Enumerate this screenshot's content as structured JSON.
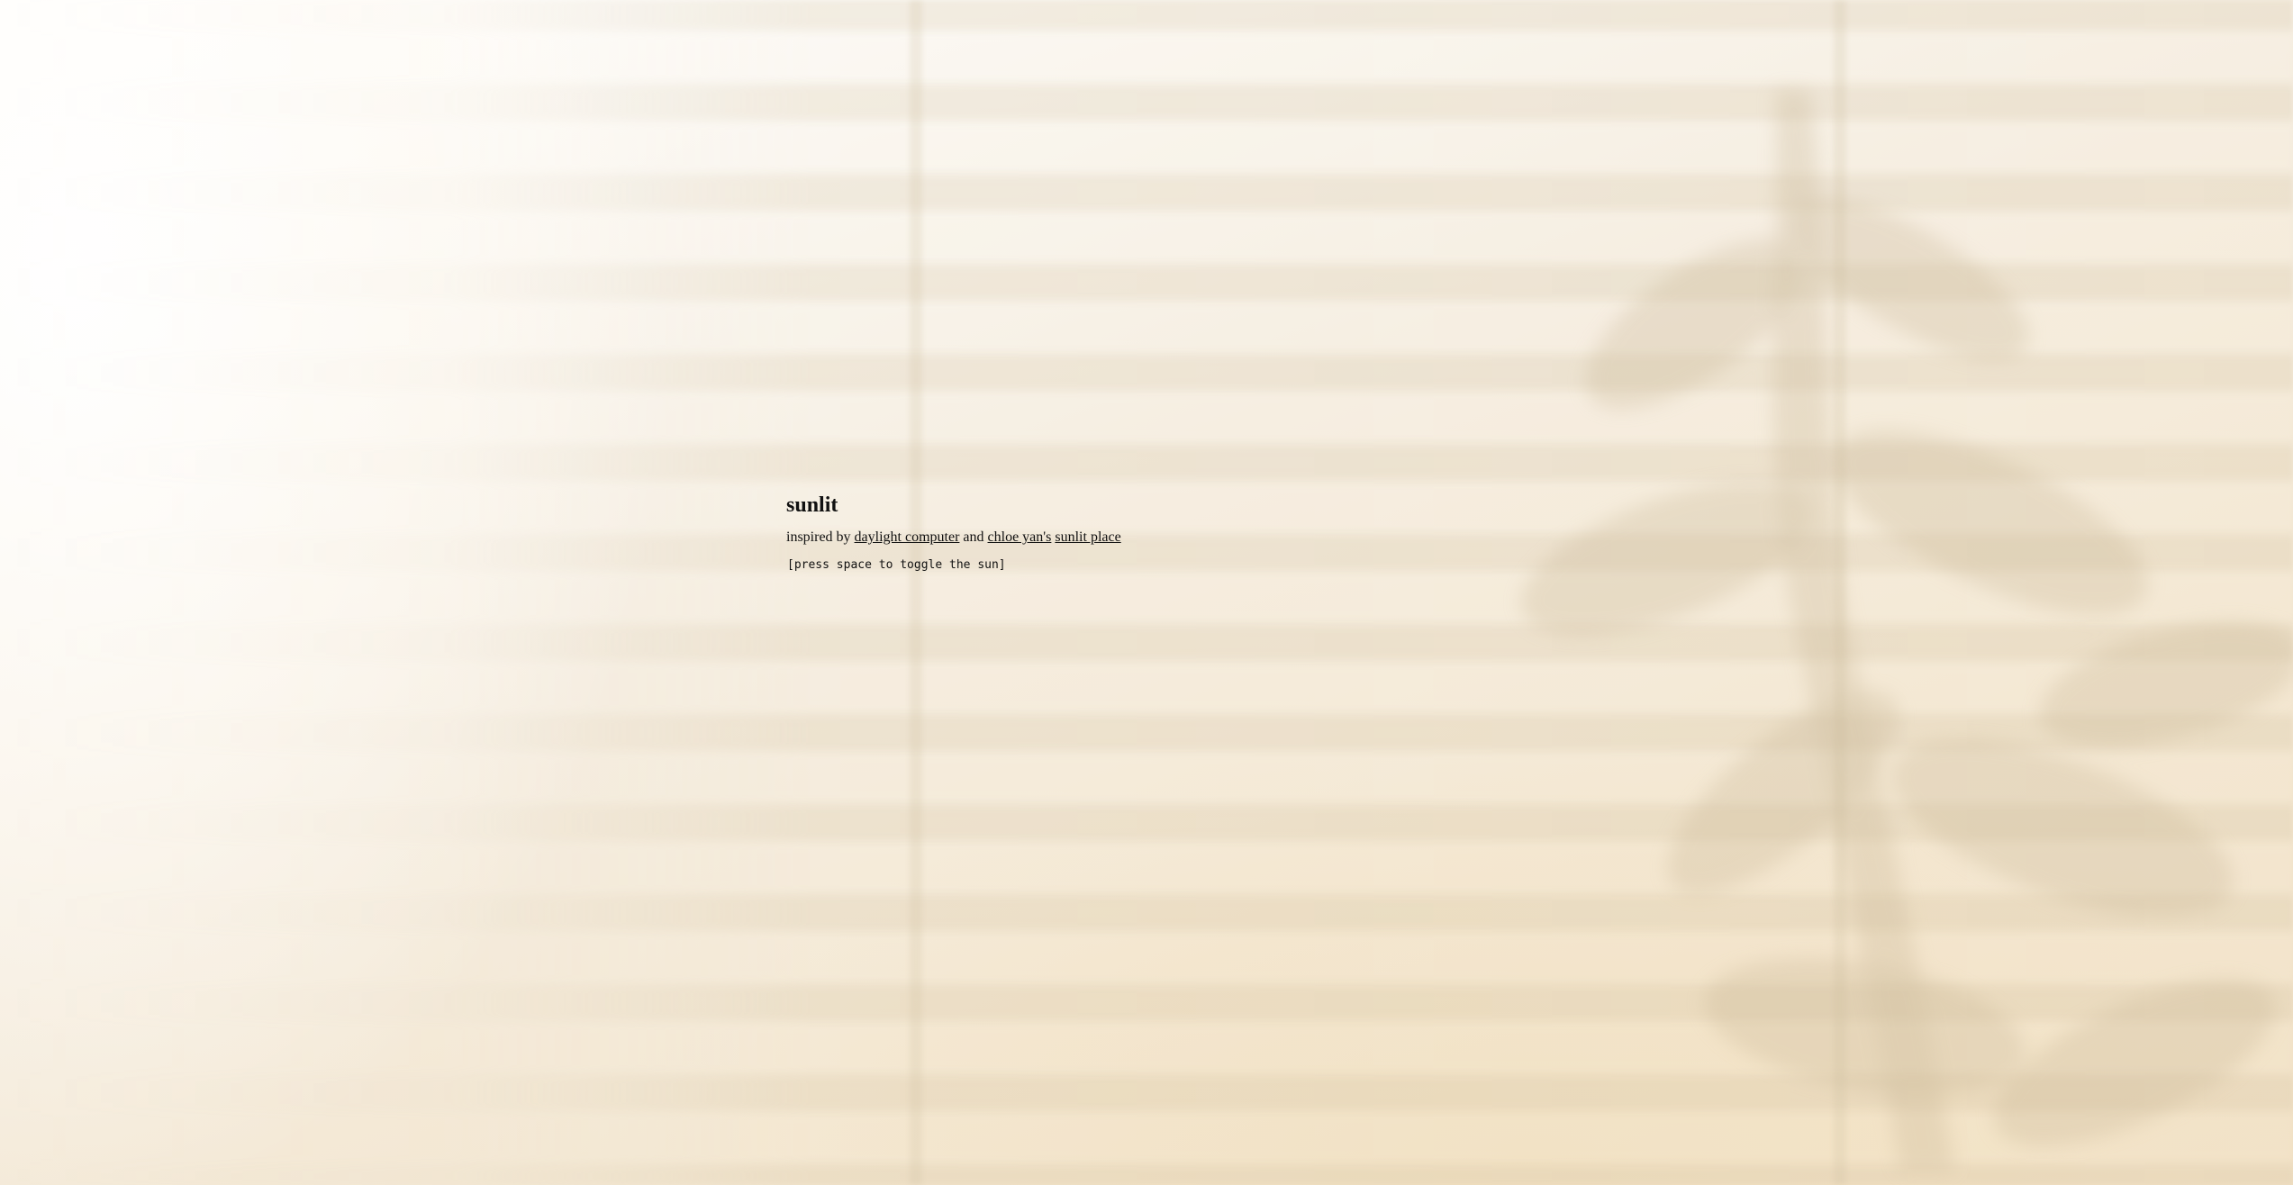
{
  "page": {
    "title": "sunlit",
    "credits": {
      "prefix": "inspired by ",
      "link1": "daylight computer",
      "joiner": " and ",
      "link2": "chloe yan's",
      "space": " ",
      "link3": "sunlit place"
    },
    "hint": "[press space to toggle the sun]"
  },
  "colors": {
    "background": "#f3ead9",
    "text": "#111111",
    "blind_shadow": "#d7c8aa"
  }
}
